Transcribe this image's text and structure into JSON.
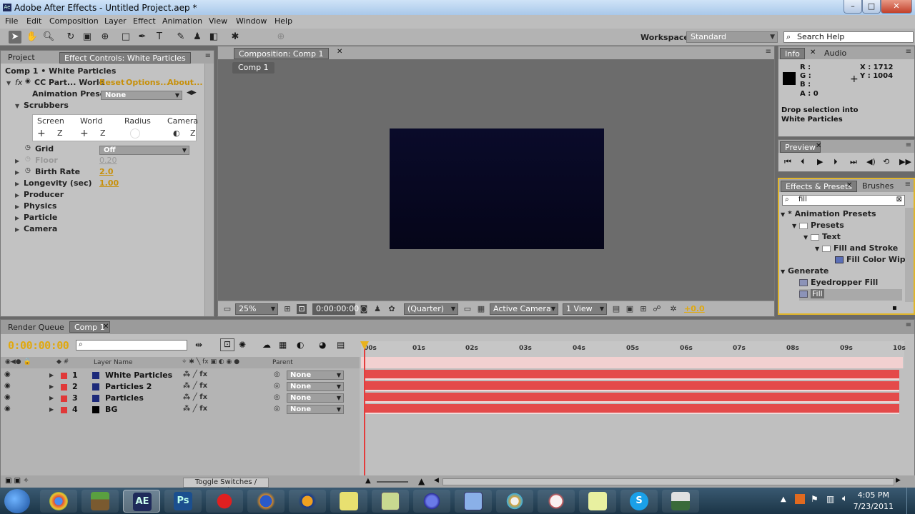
{
  "window": {
    "app_icon": "Ae",
    "title": "Adobe After Effects - Untitled Project.aep *",
    "minimize": "–",
    "maximize": "□",
    "close": "✕"
  },
  "menu": [
    "File",
    "Edit",
    "Composition",
    "Layer",
    "Effect",
    "Animation",
    "View",
    "Window",
    "Help"
  ],
  "toolbar": {
    "workspace_label": "Workspace:",
    "workspace_value": "Standard",
    "search_help_placeholder": "Search Help"
  },
  "left_panel": {
    "tabs": [
      "Project",
      "Effect Controls: White Particles"
    ],
    "breadcrumb": "Comp 1 • White Particles",
    "effect_name": "CC Part... World",
    "reset": "Reset",
    "options": "Options...",
    "about": "About...",
    "animation_presets_label": "Animation Presets:",
    "animation_presets_value": "None",
    "scrubbers_label": "Scrubbers",
    "scrubber_labels": [
      "Screen",
      "World",
      "Radius",
      "Camera"
    ],
    "scrubber_z": "Z",
    "grid_label": "Grid",
    "grid_value": "Off",
    "floor_label": "Floor",
    "floor_value": "0.20",
    "birth_rate_label": "Birth Rate",
    "birth_rate_value": "2.0",
    "longevity_label": "Longevity (sec)",
    "longevity_value": "1.00",
    "groups": [
      "Producer",
      "Physics",
      "Particle",
      "Camera"
    ]
  },
  "composition": {
    "tab": "Composition: Comp 1",
    "subtab": "Comp 1",
    "zoom": "25%",
    "timecode": "0:00:00:00",
    "resolution": "(Quarter)",
    "camera": "Active Camera",
    "views": "1 View",
    "exposure": "+0.0",
    "canvas_color": "#090a28"
  },
  "info": {
    "tabs": [
      "Info",
      "Audio"
    ],
    "r": "R :",
    "g": "G :",
    "b": "B :",
    "a": "A : 0",
    "x": "X : 1712",
    "y": "Y : 1004",
    "message_line1": "Drop selection into",
    "message_line2": "White Particles"
  },
  "preview": {
    "tab": "Preview"
  },
  "effects_presets": {
    "tabs": [
      "Effects & Presets",
      "Brushes"
    ],
    "search_value": "fill",
    "tree": [
      {
        "label": "* Animation Presets",
        "indent": 0,
        "type": "root"
      },
      {
        "label": "Presets",
        "indent": 1,
        "type": "folder"
      },
      {
        "label": "Text",
        "indent": 2,
        "type": "folder"
      },
      {
        "label": "Fill and Stroke",
        "indent": 3,
        "type": "folder"
      },
      {
        "label": "Fill Color Wipe",
        "indent": 4,
        "type": "preset"
      },
      {
        "label": "Generate",
        "indent": 0,
        "type": "root"
      },
      {
        "label": "Eyedropper Fill",
        "indent": 1,
        "type": "effect"
      },
      {
        "label": "Fill",
        "indent": 1,
        "type": "effect",
        "selected": true
      }
    ]
  },
  "timeline": {
    "tabs": [
      "Render Queue",
      "Comp 1"
    ],
    "timecode": "0:00:00:00",
    "col_layer_name": "Layer Name",
    "col_parent": "Parent",
    "ruler_ticks": [
      "00s",
      "01s",
      "02s",
      "03s",
      "04s",
      "05s",
      "06s",
      "07s",
      "08s",
      "09s",
      "10s"
    ],
    "layers": [
      {
        "num": "1",
        "name": "White Particles",
        "color": "#1d2a7a",
        "parent": "None"
      },
      {
        "num": "2",
        "name": "Particles 2",
        "color": "#1d2a7a",
        "parent": "None"
      },
      {
        "num": "3",
        "name": "Particles",
        "color": "#1d2a7a",
        "parent": "None"
      },
      {
        "num": "4",
        "name": "BG",
        "color": "#000000",
        "parent": "None"
      }
    ],
    "toggle_label": "Toggle Switches / Modes",
    "bar_color": "#e44a4a"
  },
  "taskbar": {
    "apps": [
      "Chrome",
      "Minecraft",
      "After Effects",
      "Photoshop",
      "Ladybug",
      "Firefox",
      "Headphones",
      "Sticky Notes",
      "Notepad",
      "Sphere",
      "Files",
      "Paint",
      "Kitty",
      "Notes",
      "Skype",
      "Tool"
    ],
    "ae_label": "AE",
    "ps_label": "Ps",
    "skype_label": "S",
    "time": "4:05 PM",
    "date": "7/23/2011"
  }
}
